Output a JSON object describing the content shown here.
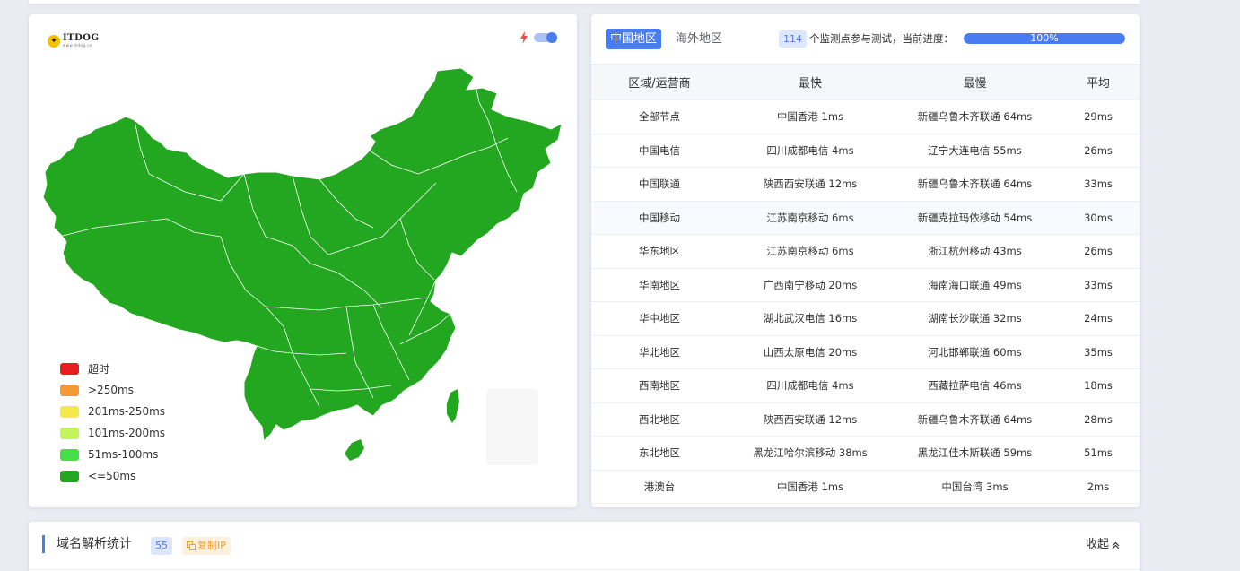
{
  "map": {
    "logo_text": "ITDOG",
    "logo_sub": "www.itdog.cn",
    "colors": {
      "region_fill": "#23a720",
      "accent": "#4a7cf1"
    },
    "legend": [
      {
        "label": "超时",
        "color": "#e91d1d"
      },
      {
        "label": ">250ms",
        "color": "#f39a36"
      },
      {
        "label": "201ms-250ms",
        "color": "#f4e84a"
      },
      {
        "label": "101ms-200ms",
        "color": "#c1f55a"
      },
      {
        "label": "51ms-100ms",
        "color": "#47de47"
      },
      {
        "label": "<=50ms",
        "color": "#23a720"
      }
    ]
  },
  "panel": {
    "tab_active": "中国地区",
    "tab_inactive": "海外地区",
    "node_count": "114",
    "node_text": "个监测点参与测试，当前进度：",
    "progress_percent": 100,
    "progress_label": "100%",
    "columns": [
      "区域/运营商",
      "最快",
      "最慢",
      "平均"
    ],
    "rows": [
      [
        "全部节点",
        "中国香港 1ms",
        "新疆乌鲁木齐联通 64ms",
        "29ms"
      ],
      [
        "中国电信",
        "四川成都电信 4ms",
        "辽宁大连电信 55ms",
        "26ms"
      ],
      [
        "中国联通",
        "陕西西安联通 12ms",
        "新疆乌鲁木齐联通 64ms",
        "33ms"
      ],
      [
        "中国移动",
        "江苏南京移动 6ms",
        "新疆克拉玛依移动 54ms",
        "30ms"
      ],
      [
        "华东地区",
        "江苏南京移动 6ms",
        "浙江杭州移动 43ms",
        "26ms"
      ],
      [
        "华南地区",
        "广西南宁移动 20ms",
        "海南海口联通 49ms",
        "33ms"
      ],
      [
        "华中地区",
        "湖北武汉电信 16ms",
        "湖南长沙联通 32ms",
        "24ms"
      ],
      [
        "华北地区",
        "山西太原电信 20ms",
        "河北邯郸联通 60ms",
        "35ms"
      ],
      [
        "西南地区",
        "四川成都电信 4ms",
        "西藏拉萨电信 46ms",
        "18ms"
      ],
      [
        "西北地区",
        "陕西西安联通 12ms",
        "新疆乌鲁木齐联通 64ms",
        "28ms"
      ],
      [
        "东北地区",
        "黑龙江哈尔滨移动 38ms",
        "黑龙江佳木斯联通 59ms",
        "51ms"
      ],
      [
        "港澳台",
        "中国香港 1ms",
        "中国台湾 3ms",
        "2ms"
      ]
    ]
  },
  "dns": {
    "title": "域名解析统计",
    "count": "55",
    "copy_label": "复制IP",
    "collapse_label": "收起"
  }
}
